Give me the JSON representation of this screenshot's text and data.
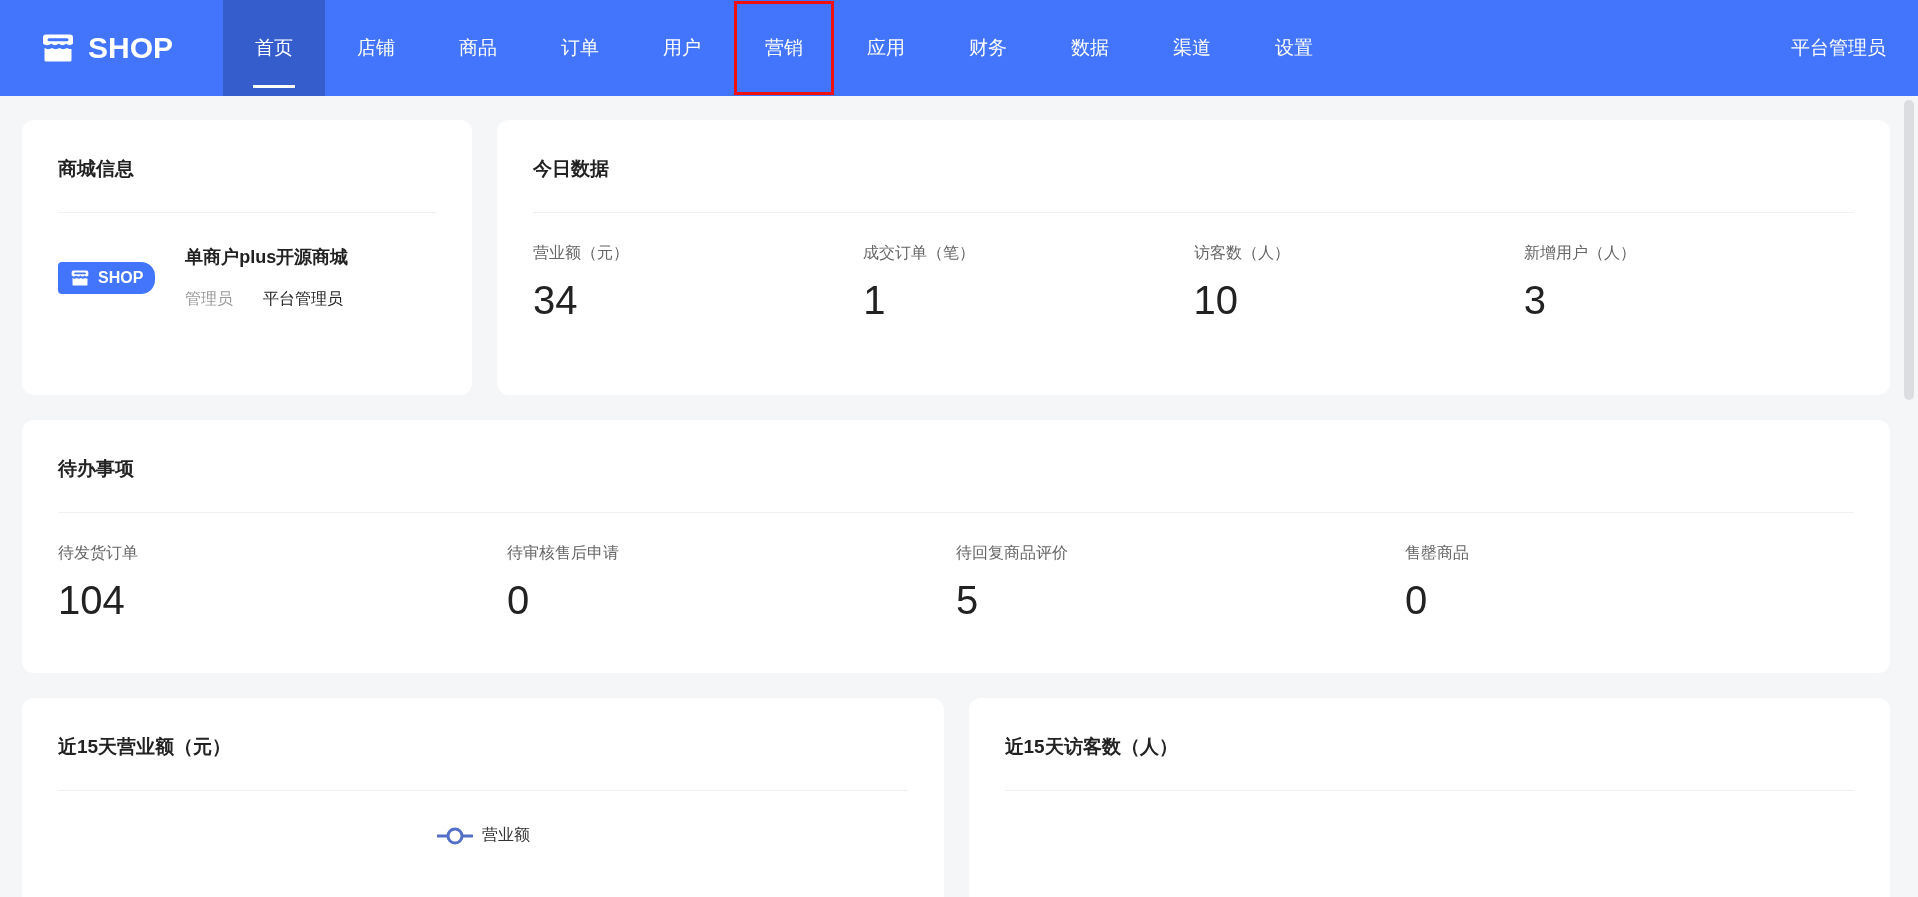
{
  "header": {
    "logo_text": "SHOP",
    "nav": [
      {
        "label": "首页",
        "selected": true,
        "highlighted": false
      },
      {
        "label": "店铺",
        "selected": false,
        "highlighted": false
      },
      {
        "label": "商品",
        "selected": false,
        "highlighted": false
      },
      {
        "label": "订单",
        "selected": false,
        "highlighted": false
      },
      {
        "label": "用户",
        "selected": false,
        "highlighted": false
      },
      {
        "label": "营销",
        "selected": false,
        "highlighted": true
      },
      {
        "label": "应用",
        "selected": false,
        "highlighted": false
      },
      {
        "label": "财务",
        "selected": false,
        "highlighted": false
      },
      {
        "label": "数据",
        "selected": false,
        "highlighted": false
      },
      {
        "label": "渠道",
        "selected": false,
        "highlighted": false
      },
      {
        "label": "设置",
        "selected": false,
        "highlighted": false
      }
    ],
    "user": "平台管理员"
  },
  "shop_info": {
    "title": "商城信息",
    "badge_text": "SHOP",
    "name": "单商户plus开源商城",
    "role_label": "管理员",
    "role_value": "平台管理员"
  },
  "today": {
    "title": "今日数据",
    "stats": [
      {
        "label": "营业额（元）",
        "value": "34"
      },
      {
        "label": "成交订单（笔）",
        "value": "1"
      },
      {
        "label": "访客数（人）",
        "value": "10"
      },
      {
        "label": "新增用户（人）",
        "value": "3"
      }
    ]
  },
  "todo": {
    "title": "待办事项",
    "items": [
      {
        "label": "待发货订单",
        "value": "104"
      },
      {
        "label": "待审核售后申请",
        "value": "0"
      },
      {
        "label": "待回复商品评价",
        "value": "5"
      },
      {
        "label": "售罄商品",
        "value": "0"
      }
    ]
  },
  "charts": [
    {
      "title": "近15天营业额（元）",
      "legend": "营业额"
    },
    {
      "title": "近15天访客数（人）"
    }
  ]
}
